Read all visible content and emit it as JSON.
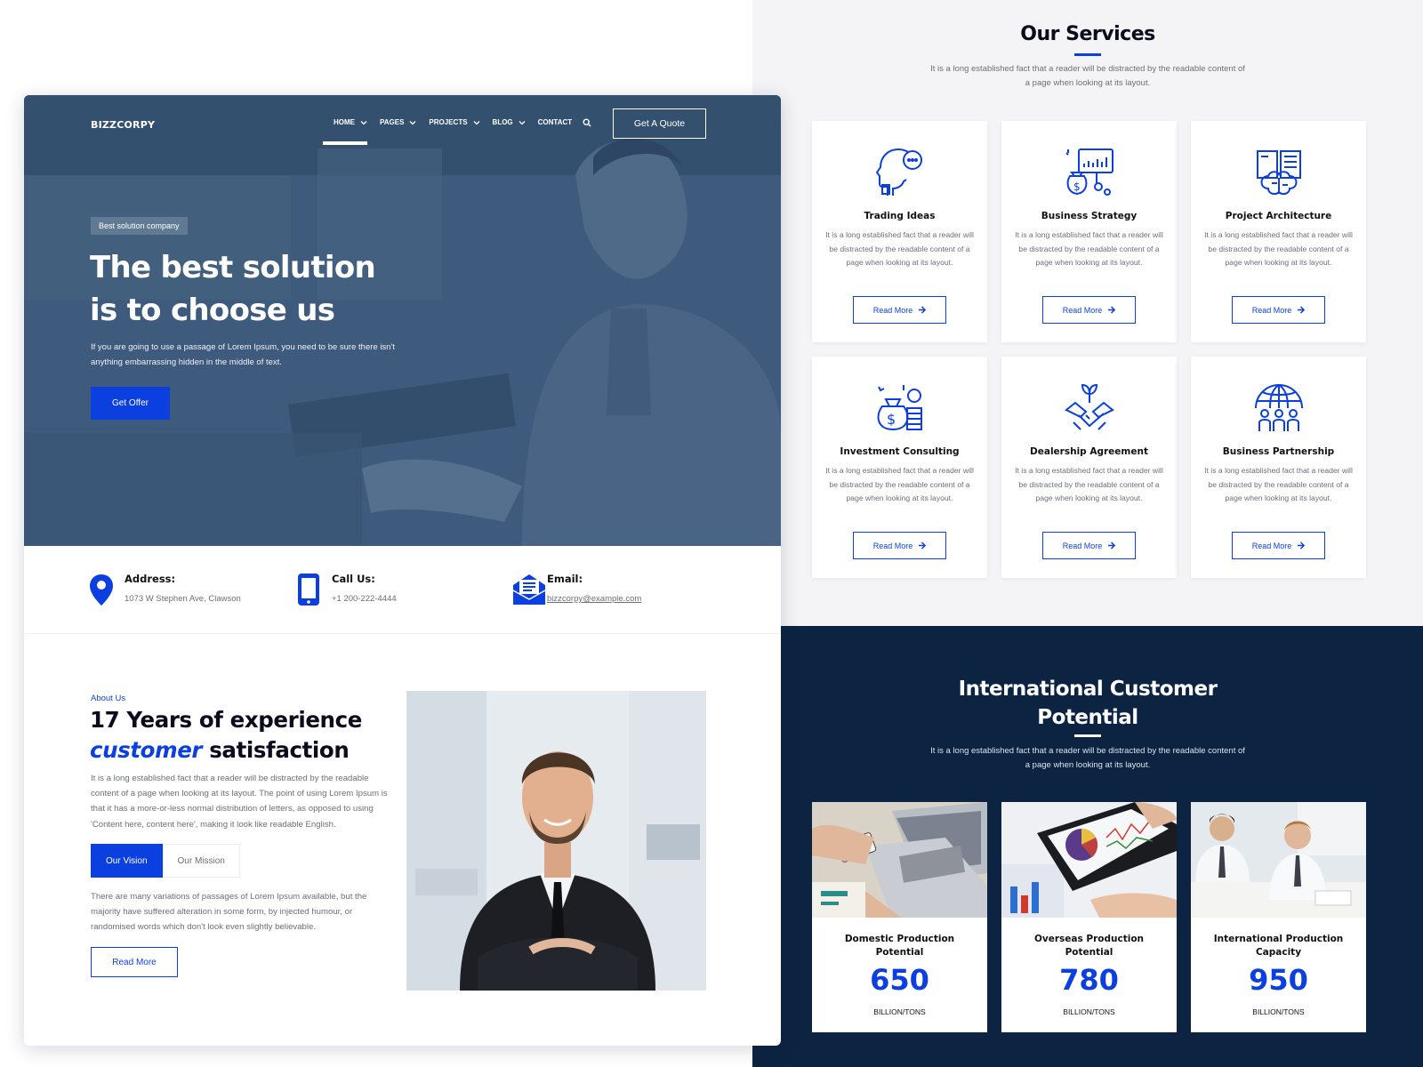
{
  "header": {
    "logo": "BIZZCORPY",
    "logo_dot": ".",
    "nav": [
      {
        "label": "HOME"
      },
      {
        "label": "PAGES"
      },
      {
        "label": "PROJECTS"
      },
      {
        "label": "BLOG"
      },
      {
        "label": "CONTACT"
      }
    ],
    "quote_button": "Get A Quote",
    "icons": [
      "chevron-down-icon",
      "search-icon"
    ]
  },
  "hero": {
    "badge": "Best solution company",
    "title_line1": "The best solution",
    "title_line2": "is to choose us",
    "text": "If you are going to use a passage of Lorem Ipsum, you need to be sure there isn't anything embarrassing hidden in the middle of text.",
    "button": "Get Offer"
  },
  "contact": [
    {
      "label": "Address:",
      "value": "1073 W Stephen Ave, Clawson",
      "icon": "map-pin-icon"
    },
    {
      "label": "Call Us:",
      "value": "+1 200-222-4444",
      "icon": "phone-icon"
    },
    {
      "label": "Email:",
      "value": "bizzcorpy@example.com",
      "icon": "envelope-icon"
    }
  ],
  "about": {
    "kicker": "About Us",
    "title_line1": "17 Years of experience",
    "title_highlight": "customer",
    "title_rest": " satisfaction",
    "text": "It is a long established fact that a reader will be distracted by the readable content of a page when looking at its layout. The point of using Lorem Ipsum is that it has a more-or-less normal distribution of letters, as opposed to using 'Content here, content here', making it look like readable English.",
    "tabs": [
      {
        "label": "Our Vision"
      },
      {
        "label": "Our Mission"
      }
    ],
    "tab_text": "There are many variations of passages of Lorem Ipsum available, but the majority have suffered alteration in some form, by injected humour, or randomised words which don't look even slightly believable.",
    "button": "Read More"
  },
  "services": {
    "title": "Our Services",
    "subtitle": "It is a long established fact that a reader will be distracted by the readable content of a page when looking at its layout.",
    "items": [
      {
        "title": "Trading Ideas",
        "text": "It is a long established fact that a reader will be distracted by the readable content of a page when looking at its layout.",
        "button": "Read More",
        "icon": "head-idea-icon"
      },
      {
        "title": "Business Strategy",
        "text": "It is a long established fact that a reader will be distracted by the readable content of a page when looking at its layout.",
        "button": "Read More",
        "icon": "money-chart-icon"
      },
      {
        "title": "Project Architecture",
        "text": "It is a long established fact that a reader will be distracted by the readable content of a page when looking at its layout.",
        "button": "Read More",
        "icon": "book-brain-icon"
      },
      {
        "title": "Investment Consulting",
        "text": "It is a long established fact that a reader will be distracted by the readable content of a page when looking at its layout.",
        "button": "Read More",
        "icon": "money-bag-coins-icon"
      },
      {
        "title": "Dealership Agreement",
        "text": "It is a long established fact that a reader will be distracted by the readable content of a page when looking at its layout.",
        "button": "Read More",
        "icon": "handshake-plant-icon"
      },
      {
        "title": "Business Partnership",
        "text": "It is a long established fact that a reader will be distracted by the readable content of a page when looking at its layout.",
        "button": "Read More",
        "icon": "global-team-icon"
      }
    ]
  },
  "stats": {
    "title_line1": "International Customer",
    "title_line2": "Potential",
    "subtitle": "It is a long established fact that a reader will be distracted by the readable content of a page when looking at its layout.",
    "items": [
      {
        "label": "Domestic Production Potential",
        "value": "650",
        "unit": "BILLION/TONS"
      },
      {
        "label": "Overseas Production Potential",
        "value": "780",
        "unit": "BILLION/TONS"
      },
      {
        "label": "International Production Capacity",
        "value": "950",
        "unit": "BILLION/TONS"
      }
    ]
  },
  "colors": {
    "accent": "#0b3fe0",
    "hero_overlay": "#3a5678",
    "dark_section": "#0c2441",
    "services_bg": "#f4f4f6"
  }
}
